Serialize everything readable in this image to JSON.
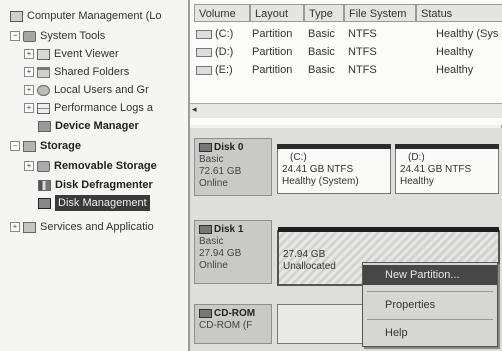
{
  "tree": {
    "root": "Computer Management (Lo",
    "system_tools": "System Tools",
    "event_viewer": "Event Viewer",
    "shared_folders": "Shared Folders",
    "local_users": "Local Users and Gr",
    "performance_logs": "Performance Logs a",
    "device_manager": "Device Manager",
    "storage": "Storage",
    "removable_storage": "Removable Storage",
    "disk_defragmenter": "Disk Defragmenter",
    "disk_management": "Disk Management",
    "services": "Services and Applicatio"
  },
  "list": {
    "columns": [
      "Volume",
      "Layout",
      "Type",
      "File System",
      "Status"
    ],
    "rows": [
      {
        "volume": "(C:)",
        "layout": "Partition",
        "type": "Basic",
        "fs": "NTFS",
        "status": "Healthy (Sys"
      },
      {
        "volume": "(D:)",
        "layout": "Partition",
        "type": "Basic",
        "fs": "NTFS",
        "status": "Healthy"
      },
      {
        "volume": "(E:)",
        "layout": "Partition",
        "type": "Basic",
        "fs": "NTFS",
        "status": "Healthy"
      }
    ],
    "scroll_left": "◂"
  },
  "disks": [
    {
      "name": "Disk 0",
      "kind": "Basic",
      "size": "72.61 GB",
      "state": "Online"
    },
    {
      "name": "Disk 1",
      "kind": "Basic",
      "size": "27.94 GB",
      "state": "Online"
    },
    {
      "name": "CD-ROM",
      "kind": "CD-ROM (F",
      "size": "",
      "state": ""
    }
  ],
  "partitions": {
    "c": {
      "label": "(C:)",
      "detail": "24.41 GB NTFS",
      "status": "Healthy (System)"
    },
    "d": {
      "label": "(D:)",
      "detail": "24.41 GB NTFS",
      "status": "Healthy"
    },
    "unalloc": {
      "size": "27.94 GB",
      "status": "Unallocated"
    }
  },
  "context_menu": {
    "new_partition": "New Partition...",
    "properties": "Properties",
    "help": "Help"
  },
  "colors": {
    "selection": "#3a3a3a",
    "partition_bar": "#2c2c2c"
  }
}
